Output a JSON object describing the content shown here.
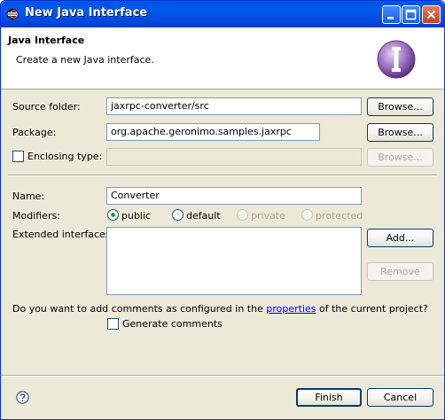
{
  "window": {
    "title": "New Java Interface"
  },
  "header": {
    "title": "Java Interface",
    "description": "Create a new Java interface."
  },
  "form": {
    "source_folder": {
      "label": "Source folder:",
      "value": "jaxrpc-converter/src",
      "button": "Browse..."
    },
    "package": {
      "label": "Package:",
      "value": "org.apache.geronimo.samples.jaxrpc",
      "button": "Browse..."
    },
    "enclosing_type": {
      "label": "Enclosing type:",
      "value": "",
      "button": "Browse...",
      "checked": false
    },
    "name": {
      "label": "Name:",
      "value": "Converter"
    },
    "modifiers": {
      "label": "Modifiers:",
      "options": [
        {
          "label": "public",
          "selected": true,
          "enabled": true
        },
        {
          "label": "default",
          "selected": false,
          "enabled": true
        },
        {
          "label": "private",
          "selected": false,
          "enabled": false
        },
        {
          "label": "protected",
          "selected": false,
          "enabled": false
        }
      ]
    },
    "extended_interfaces": {
      "label": "Extended interfaces:",
      "add_button": "Add...",
      "remove_button": "Remove"
    },
    "comments": {
      "question_before": "Do you want to add comments as configured in the ",
      "link_text": "properties",
      "question_after": " of the current project?",
      "checkbox_label": "Generate comments",
      "checked": false
    }
  },
  "footer": {
    "finish_button": "Finish",
    "cancel_button": "Cancel"
  },
  "icons": {
    "help": "help-icon",
    "wizard": "interface-wizard-icon",
    "app": "eclipse-icon"
  }
}
